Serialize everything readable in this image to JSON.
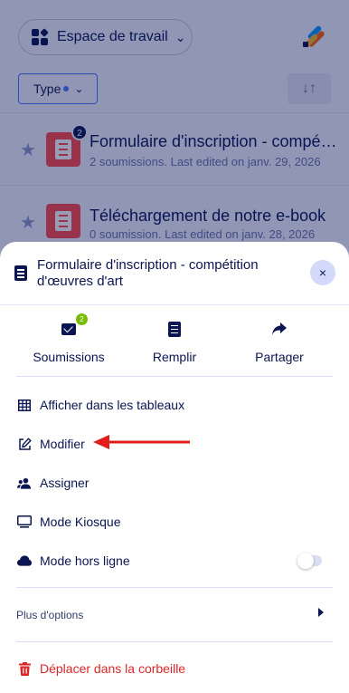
{
  "background": {
    "workspace_label": "Espace de travail",
    "type_filter_label": "Type",
    "forms": [
      {
        "title": "Formulaire d'inscription - compétit...",
        "meta": "2 soumissions. Last edited on janv. 29, 2026",
        "badge": "2"
      },
      {
        "title": "Téléchargement de notre e-book",
        "meta": "0 soumission. Last edited on janv. 28, 2026"
      }
    ]
  },
  "sheet": {
    "title": "Formulaire d'inscription - compétition d'œuvres d'art",
    "close_label": "×",
    "actions": [
      {
        "label": "Soumissions",
        "icon": "envelope-check-icon",
        "badge": "2"
      },
      {
        "label": "Remplir",
        "icon": "form-icon"
      },
      {
        "label": "Partager",
        "icon": "share-arrow-icon"
      }
    ],
    "menu": [
      {
        "label": "Afficher dans les tableaux",
        "icon": "table-icon"
      },
      {
        "label": "Modifier",
        "icon": "edit-icon"
      },
      {
        "label": "Assigner",
        "icon": "users-icon"
      },
      {
        "label": "Mode Kiosque",
        "icon": "monitor-icon"
      },
      {
        "label": "Mode hors ligne",
        "icon": "cloud-icon",
        "toggle": false
      }
    ],
    "more_options_label": "Plus d'options",
    "trash_label": "Déplacer dans la corbeille"
  },
  "colors": {
    "accent": "#4277ff",
    "navy": "#0a1551",
    "danger": "#dc2626",
    "badge_green": "#78bb07",
    "form_red": "#ff4948"
  }
}
